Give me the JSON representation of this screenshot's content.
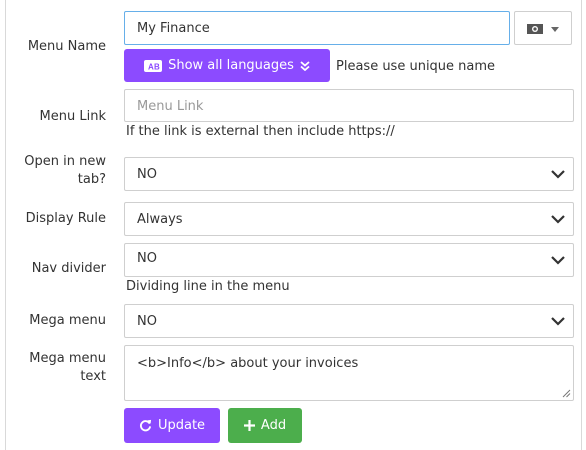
{
  "colors": {
    "purple": "#8c4bff",
    "green": "#4cae4c",
    "focus": "#66afe9"
  },
  "menu_name": {
    "label": "Menu Name",
    "value": "My Finance",
    "languages_button": "Show all languages",
    "hint": "Please use unique name",
    "flag_icon": "flag-icon",
    "dropdown_icon": "caret-down-icon"
  },
  "menu_link": {
    "label": "Menu Link",
    "placeholder": "Menu Link",
    "help": "If the link is external then include https://"
  },
  "open_new_tab": {
    "label": "Open in new tab?",
    "value": "NO"
  },
  "display_rule": {
    "label": "Display Rule",
    "value": "Always"
  },
  "nav_divider": {
    "label": "Nav divider",
    "value": "NO",
    "help": "Dividing line in the menu"
  },
  "mega_menu": {
    "label": "Mega menu",
    "value": "NO"
  },
  "mega_menu_text": {
    "label": "Mega menu text",
    "value": "<b>Info</b> about your invoices"
  },
  "buttons": {
    "update": "Update",
    "add": "Add"
  }
}
